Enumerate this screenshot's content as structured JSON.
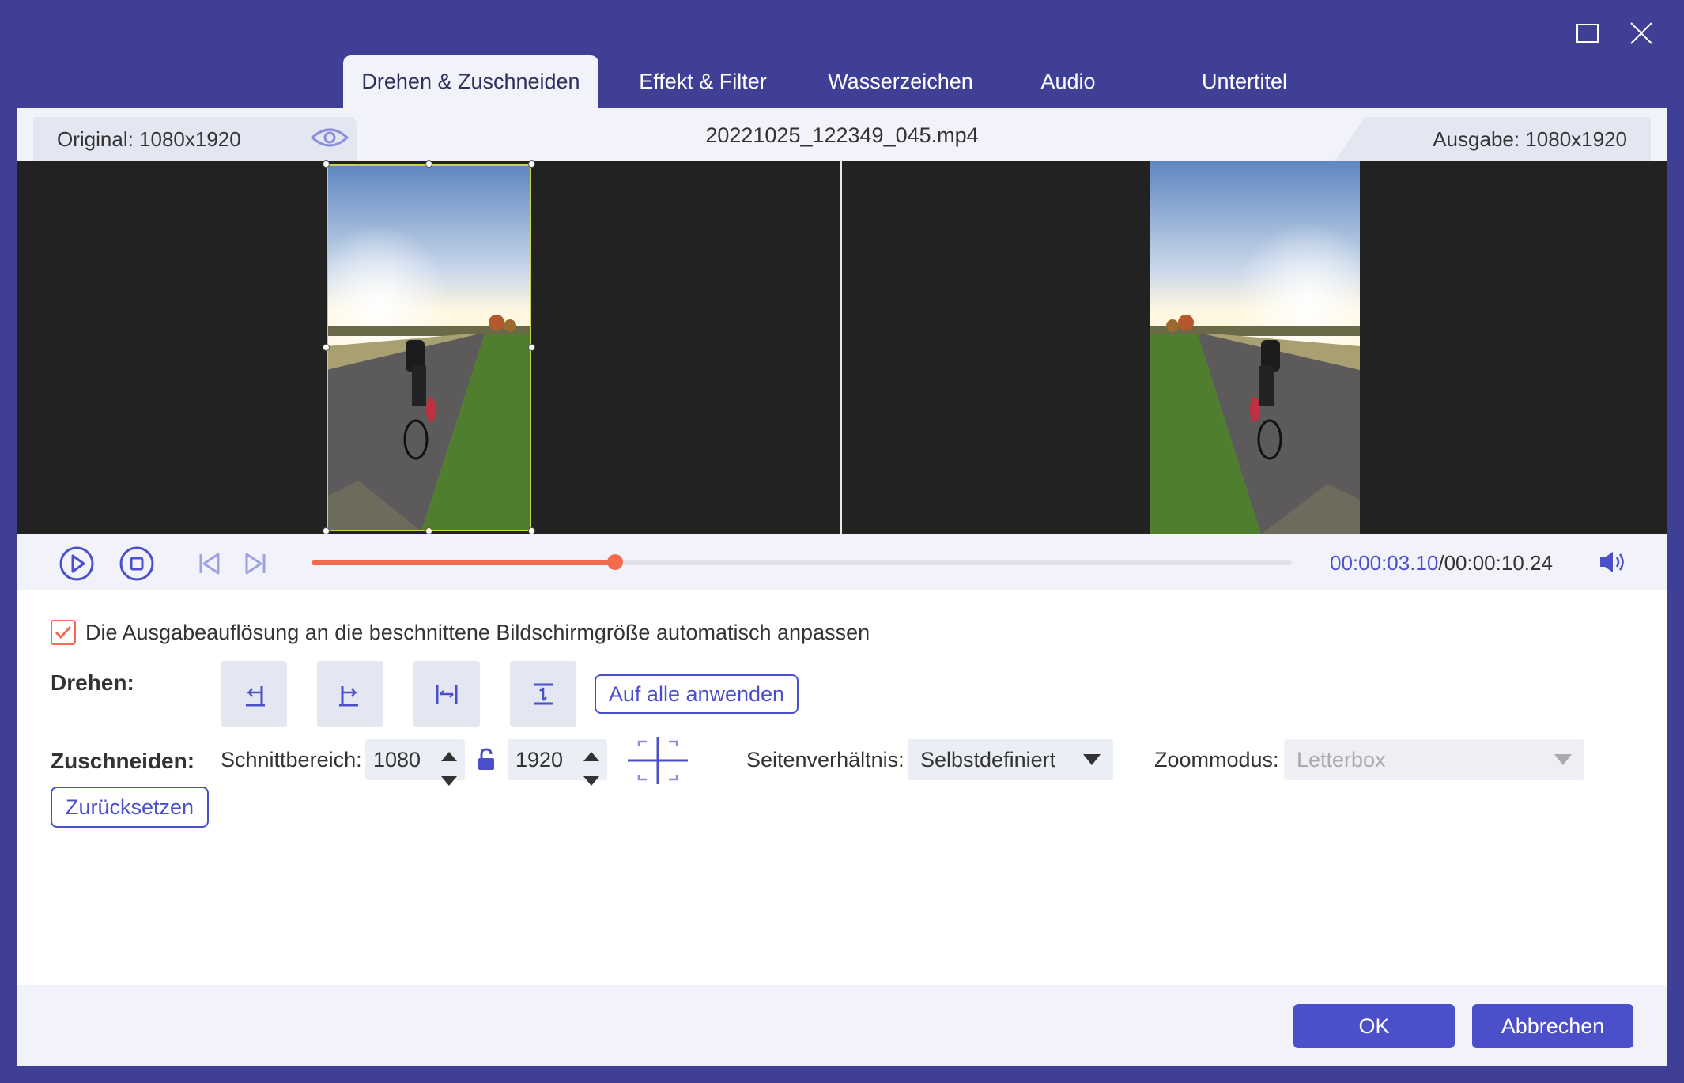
{
  "window": {
    "maximize_icon": "maximize-icon",
    "close_icon": "close-icon"
  },
  "tabs": [
    {
      "label": "Drehen & Zuschneiden",
      "active": true
    },
    {
      "label": "Effekt & Filter",
      "active": false
    },
    {
      "label": "Wasserzeichen",
      "active": false
    },
    {
      "label": "Audio",
      "active": false
    },
    {
      "label": "Untertitel",
      "active": false
    }
  ],
  "infobar": {
    "original": "Original: 1080x1920",
    "filename": "20221025_122349_045.mp4",
    "output": "Ausgabe: 1080x1920"
  },
  "player": {
    "time_current": "00:00:03.10",
    "time_total": "/00:00:10.24",
    "progress": 0.31
  },
  "settings": {
    "auto_resize_label": "Die Ausgabeauflösung an die beschnittene Bildschirmgröße automatisch anpassen",
    "auto_resize_checked": true,
    "rotate_label": "Drehen:",
    "apply_all_label": "Auf alle anwenden",
    "crop_label": "Zuschneiden:",
    "crop_area_label": "Schnittbereich:",
    "crop_width": "1080",
    "crop_height": "1920",
    "aspect_label": "Seitenverhältnis:",
    "aspect_value": "Selbstdefiniert",
    "zoom_label": "Zoommodus:",
    "zoom_value": "Letterbox",
    "reset_label": "Zurücksetzen"
  },
  "footer": {
    "ok_label": "OK",
    "cancel_label": "Abbrechen"
  },
  "colors": {
    "frame": "#3f3f96",
    "accent": "#4b4fc9",
    "progress": "#f26b4e"
  }
}
